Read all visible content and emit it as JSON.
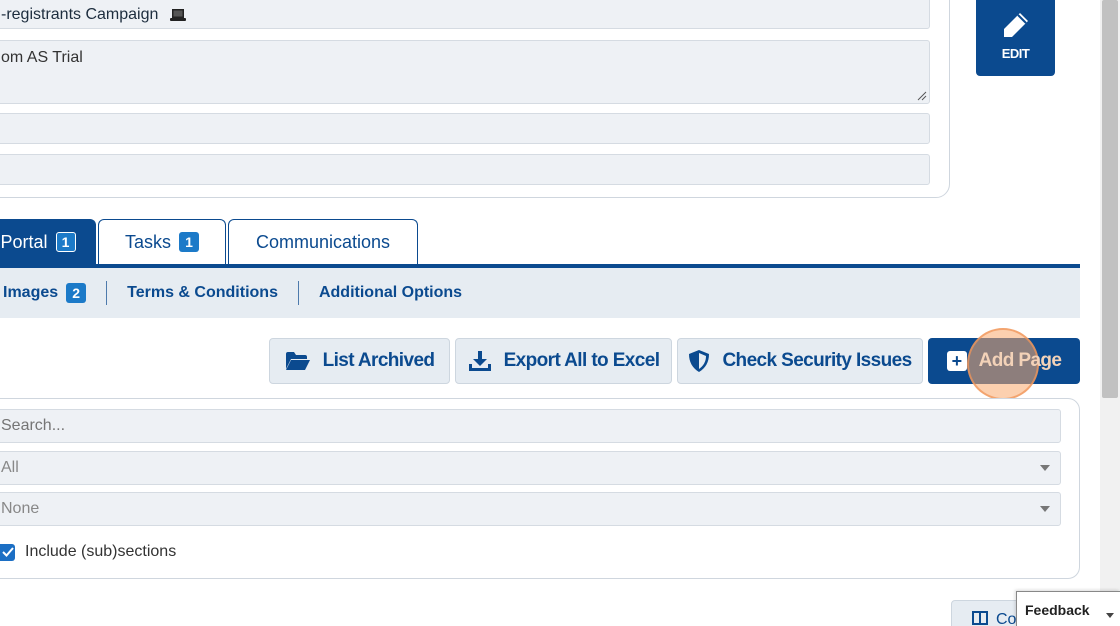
{
  "form": {
    "name_value": "-registrants Campaign",
    "description_value": "om AS Trial",
    "field3_value": "",
    "field4_value": ""
  },
  "edit_button": {
    "label": "EDIT"
  },
  "tabs": [
    {
      "label": "Portal",
      "badge": "1",
      "active": true
    },
    {
      "label": "Tasks",
      "badge": "1",
      "active": false
    },
    {
      "label": "Communications",
      "badge": "",
      "active": false
    }
  ],
  "subnav": {
    "images_label": "Images",
    "images_badge": "2",
    "terms_label": "Terms & Conditions",
    "options_label": "Additional Options"
  },
  "actions": {
    "list_archived": "List Archived",
    "export_excel": "Export All to Excel",
    "check_security": "Check Security Issues",
    "add_page": "Add Page"
  },
  "filters": {
    "search_placeholder": "Search...",
    "select1_value": "All",
    "select2_value": "None",
    "include_subsections_label": "Include (sub)sections",
    "include_subsections_checked": true
  },
  "bottom": {
    "columns_label": "Co",
    "feedback_label": "Feedback"
  },
  "colors": {
    "primary": "#0b4a8f",
    "badge": "#1c7ac8",
    "light_bg": "#e6ecf2",
    "highlight": "#f5a46a"
  }
}
